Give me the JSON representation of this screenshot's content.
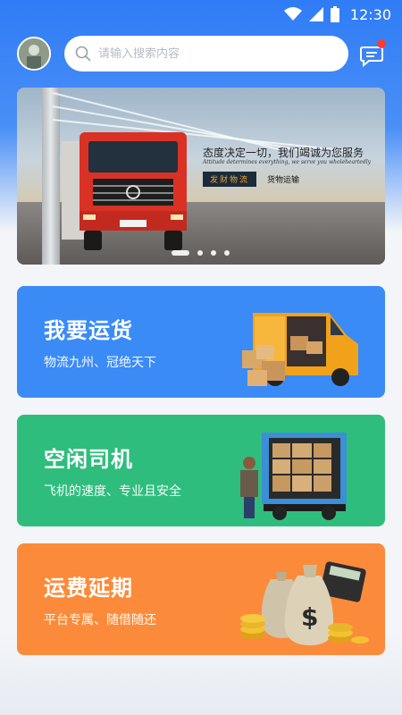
{
  "status_bar": {
    "time": "12:30"
  },
  "search": {
    "placeholder": "请输入搜索内容"
  },
  "banner": {
    "title": "态度决定一切，我们竭诚为您服务",
    "subtitle": "Attitude determines everything, we serve you wholeheartedly",
    "tag": "发财物流",
    "tag_secondary": "货物运输",
    "slide_count": 4,
    "active_slide": 1
  },
  "cards": [
    {
      "title": "我要运货",
      "subtitle": "物流九州、冠绝天下",
      "color": "#3b8bf6",
      "art": "van-with-boxes"
    },
    {
      "title": "空闲司机",
      "subtitle": "飞机的速度、专业且安全",
      "color": "#2fbd7e",
      "art": "driver-with-truck"
    },
    {
      "title": "运费延期",
      "subtitle": "平台专属、随借随还",
      "color": "#fb8b3a",
      "art": "money-bags-and-calculator"
    }
  ],
  "colors": {
    "header_blue": "#2f7cf6",
    "notification_dot": "#ff3b30"
  }
}
